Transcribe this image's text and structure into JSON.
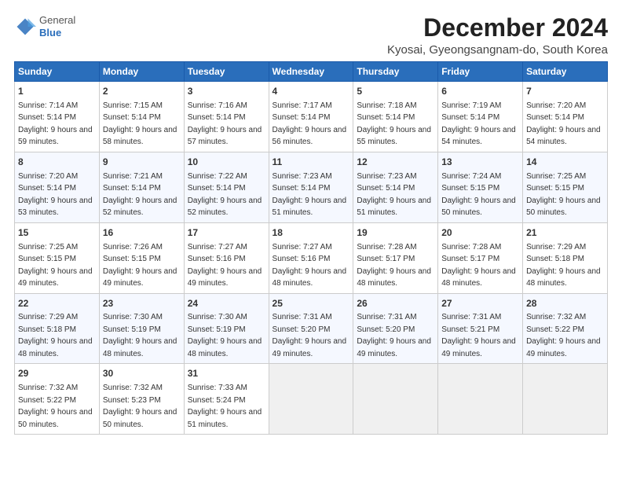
{
  "logo": {
    "general": "General",
    "blue": "Blue"
  },
  "header": {
    "month": "December 2024",
    "location": "Kyosai, Gyeongsangnam-do, South Korea"
  },
  "columns": [
    "Sunday",
    "Monday",
    "Tuesday",
    "Wednesday",
    "Thursday",
    "Friday",
    "Saturday"
  ],
  "weeks": [
    [
      {
        "day": "1",
        "sunrise": "Sunrise: 7:14 AM",
        "sunset": "Sunset: 5:14 PM",
        "daylight": "Daylight: 9 hours and 59 minutes."
      },
      {
        "day": "2",
        "sunrise": "Sunrise: 7:15 AM",
        "sunset": "Sunset: 5:14 PM",
        "daylight": "Daylight: 9 hours and 58 minutes."
      },
      {
        "day": "3",
        "sunrise": "Sunrise: 7:16 AM",
        "sunset": "Sunset: 5:14 PM",
        "daylight": "Daylight: 9 hours and 57 minutes."
      },
      {
        "day": "4",
        "sunrise": "Sunrise: 7:17 AM",
        "sunset": "Sunset: 5:14 PM",
        "daylight": "Daylight: 9 hours and 56 minutes."
      },
      {
        "day": "5",
        "sunrise": "Sunrise: 7:18 AM",
        "sunset": "Sunset: 5:14 PM",
        "daylight": "Daylight: 9 hours and 55 minutes."
      },
      {
        "day": "6",
        "sunrise": "Sunrise: 7:19 AM",
        "sunset": "Sunset: 5:14 PM",
        "daylight": "Daylight: 9 hours and 54 minutes."
      },
      {
        "day": "7",
        "sunrise": "Sunrise: 7:20 AM",
        "sunset": "Sunset: 5:14 PM",
        "daylight": "Daylight: 9 hours and 54 minutes."
      }
    ],
    [
      {
        "day": "8",
        "sunrise": "Sunrise: 7:20 AM",
        "sunset": "Sunset: 5:14 PM",
        "daylight": "Daylight: 9 hours and 53 minutes."
      },
      {
        "day": "9",
        "sunrise": "Sunrise: 7:21 AM",
        "sunset": "Sunset: 5:14 PM",
        "daylight": "Daylight: 9 hours and 52 minutes."
      },
      {
        "day": "10",
        "sunrise": "Sunrise: 7:22 AM",
        "sunset": "Sunset: 5:14 PM",
        "daylight": "Daylight: 9 hours and 52 minutes."
      },
      {
        "day": "11",
        "sunrise": "Sunrise: 7:23 AM",
        "sunset": "Sunset: 5:14 PM",
        "daylight": "Daylight: 9 hours and 51 minutes."
      },
      {
        "day": "12",
        "sunrise": "Sunrise: 7:23 AM",
        "sunset": "Sunset: 5:14 PM",
        "daylight": "Daylight: 9 hours and 51 minutes."
      },
      {
        "day": "13",
        "sunrise": "Sunrise: 7:24 AM",
        "sunset": "Sunset: 5:15 PM",
        "daylight": "Daylight: 9 hours and 50 minutes."
      },
      {
        "day": "14",
        "sunrise": "Sunrise: 7:25 AM",
        "sunset": "Sunset: 5:15 PM",
        "daylight": "Daylight: 9 hours and 50 minutes."
      }
    ],
    [
      {
        "day": "15",
        "sunrise": "Sunrise: 7:25 AM",
        "sunset": "Sunset: 5:15 PM",
        "daylight": "Daylight: 9 hours and 49 minutes."
      },
      {
        "day": "16",
        "sunrise": "Sunrise: 7:26 AM",
        "sunset": "Sunset: 5:15 PM",
        "daylight": "Daylight: 9 hours and 49 minutes."
      },
      {
        "day": "17",
        "sunrise": "Sunrise: 7:27 AM",
        "sunset": "Sunset: 5:16 PM",
        "daylight": "Daylight: 9 hours and 49 minutes."
      },
      {
        "day": "18",
        "sunrise": "Sunrise: 7:27 AM",
        "sunset": "Sunset: 5:16 PM",
        "daylight": "Daylight: 9 hours and 48 minutes."
      },
      {
        "day": "19",
        "sunrise": "Sunrise: 7:28 AM",
        "sunset": "Sunset: 5:17 PM",
        "daylight": "Daylight: 9 hours and 48 minutes."
      },
      {
        "day": "20",
        "sunrise": "Sunrise: 7:28 AM",
        "sunset": "Sunset: 5:17 PM",
        "daylight": "Daylight: 9 hours and 48 minutes."
      },
      {
        "day": "21",
        "sunrise": "Sunrise: 7:29 AM",
        "sunset": "Sunset: 5:18 PM",
        "daylight": "Daylight: 9 hours and 48 minutes."
      }
    ],
    [
      {
        "day": "22",
        "sunrise": "Sunrise: 7:29 AM",
        "sunset": "Sunset: 5:18 PM",
        "daylight": "Daylight: 9 hours and 48 minutes."
      },
      {
        "day": "23",
        "sunrise": "Sunrise: 7:30 AM",
        "sunset": "Sunset: 5:19 PM",
        "daylight": "Daylight: 9 hours and 48 minutes."
      },
      {
        "day": "24",
        "sunrise": "Sunrise: 7:30 AM",
        "sunset": "Sunset: 5:19 PM",
        "daylight": "Daylight: 9 hours and 48 minutes."
      },
      {
        "day": "25",
        "sunrise": "Sunrise: 7:31 AM",
        "sunset": "Sunset: 5:20 PM",
        "daylight": "Daylight: 9 hours and 49 minutes."
      },
      {
        "day": "26",
        "sunrise": "Sunrise: 7:31 AM",
        "sunset": "Sunset: 5:20 PM",
        "daylight": "Daylight: 9 hours and 49 minutes."
      },
      {
        "day": "27",
        "sunrise": "Sunrise: 7:31 AM",
        "sunset": "Sunset: 5:21 PM",
        "daylight": "Daylight: 9 hours and 49 minutes."
      },
      {
        "day": "28",
        "sunrise": "Sunrise: 7:32 AM",
        "sunset": "Sunset: 5:22 PM",
        "daylight": "Daylight: 9 hours and 49 minutes."
      }
    ],
    [
      {
        "day": "29",
        "sunrise": "Sunrise: 7:32 AM",
        "sunset": "Sunset: 5:22 PM",
        "daylight": "Daylight: 9 hours and 50 minutes."
      },
      {
        "day": "30",
        "sunrise": "Sunrise: 7:32 AM",
        "sunset": "Sunset: 5:23 PM",
        "daylight": "Daylight: 9 hours and 50 minutes."
      },
      {
        "day": "31",
        "sunrise": "Sunrise: 7:33 AM",
        "sunset": "Sunset: 5:24 PM",
        "daylight": "Daylight: 9 hours and 51 minutes."
      },
      null,
      null,
      null,
      null
    ]
  ]
}
